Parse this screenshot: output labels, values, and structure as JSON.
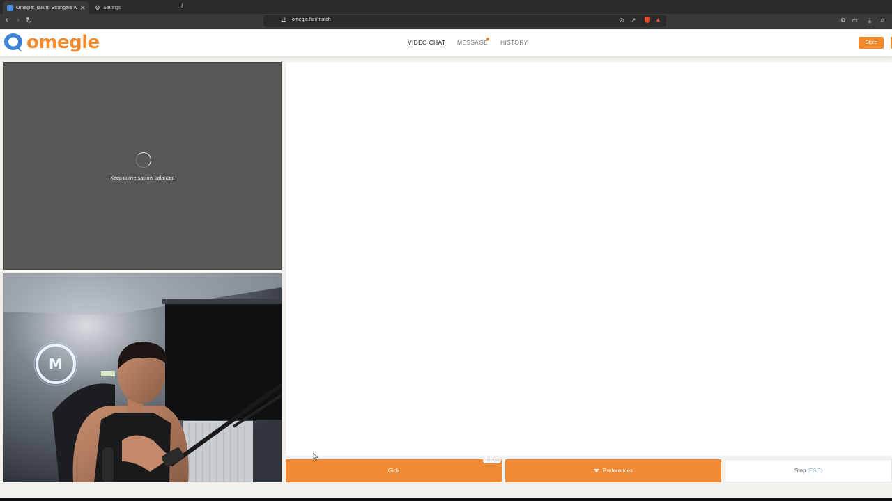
{
  "browser": {
    "tabs": [
      {
        "label": "Omegle: Talk to Strangers wit",
        "active": true
      },
      {
        "label": "Settings",
        "active": false
      }
    ],
    "url": "omegle.fun/match"
  },
  "site": {
    "logo_text": "omegle",
    "brand_color": "#f08a2c",
    "nav": {
      "video_chat": "VIDEO CHAT",
      "message": "MESSAGE",
      "history": "HISTORY"
    },
    "store_label": "Store",
    "stranger_status": "Keep conversations balanced",
    "buttons": {
      "girls": "Girls",
      "girls_counter": "150/150",
      "preferences": "Preferences",
      "stop": "Stop",
      "stop_hint": "(ESC)"
    }
  }
}
